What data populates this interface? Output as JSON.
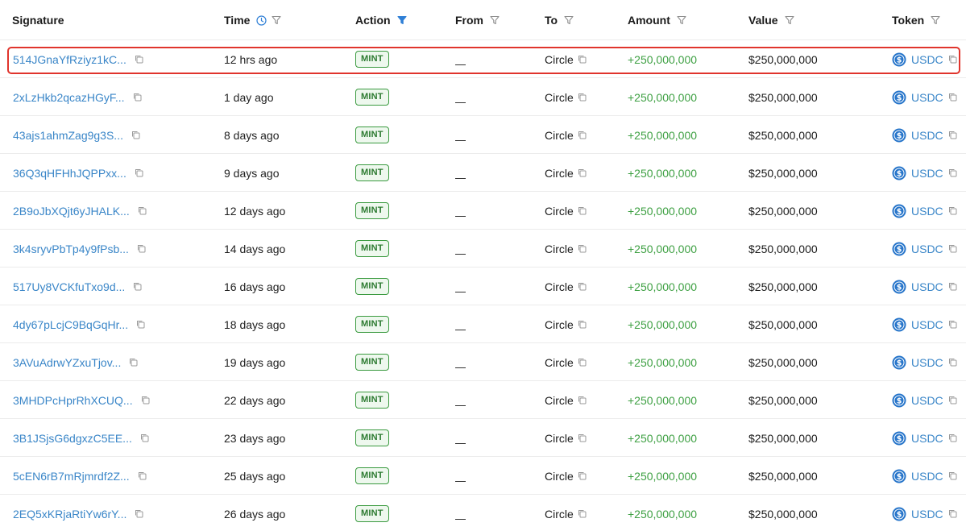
{
  "colors": {
    "link": "#3a86c8",
    "amount": "#3ea043",
    "badge_border": "#3a9a3f",
    "badge_text": "#2c7a30",
    "highlight": "#e0342c",
    "filter_active": "#2f7fd6"
  },
  "columns": {
    "signature": "Signature",
    "time": "Time",
    "action": "Action",
    "from": "From",
    "to": "To",
    "amount": "Amount",
    "value": "Value",
    "token": "Token"
  },
  "rows": [
    {
      "signature": "514JGnaYfRziyz1kC...",
      "time": "12 hrs ago",
      "action": "MINT",
      "from": "",
      "to": "Circle",
      "amount": "+250,000,000",
      "value": "$250,000,000",
      "token": "USDC"
    },
    {
      "signature": "2xLzHkb2qcazHGyF...",
      "time": "1 day ago",
      "action": "MINT",
      "from": "",
      "to": "Circle",
      "amount": "+250,000,000",
      "value": "$250,000,000",
      "token": "USDC"
    },
    {
      "signature": "43ajs1ahmZag9g3S...",
      "time": "8 days ago",
      "action": "MINT",
      "from": "",
      "to": "Circle",
      "amount": "+250,000,000",
      "value": "$250,000,000",
      "token": "USDC"
    },
    {
      "signature": "36Q3qHFHhJQPPxx...",
      "time": "9 days ago",
      "action": "MINT",
      "from": "",
      "to": "Circle",
      "amount": "+250,000,000",
      "value": "$250,000,000",
      "token": "USDC"
    },
    {
      "signature": "2B9oJbXQjt6yJHALK...",
      "time": "12 days ago",
      "action": "MINT",
      "from": "",
      "to": "Circle",
      "amount": "+250,000,000",
      "value": "$250,000,000",
      "token": "USDC"
    },
    {
      "signature": "3k4sryvPbTp4y9fPsb...",
      "time": "14 days ago",
      "action": "MINT",
      "from": "",
      "to": "Circle",
      "amount": "+250,000,000",
      "value": "$250,000,000",
      "token": "USDC"
    },
    {
      "signature": "517Uy8VCKfuTxo9d...",
      "time": "16 days ago",
      "action": "MINT",
      "from": "",
      "to": "Circle",
      "amount": "+250,000,000",
      "value": "$250,000,000",
      "token": "USDC"
    },
    {
      "signature": "4dy67pLcjC9BqGqHr...",
      "time": "18 days ago",
      "action": "MINT",
      "from": "",
      "to": "Circle",
      "amount": "+250,000,000",
      "value": "$250,000,000",
      "token": "USDC"
    },
    {
      "signature": "3AVuAdrwYZxuTjov...",
      "time": "19 days ago",
      "action": "MINT",
      "from": "",
      "to": "Circle",
      "amount": "+250,000,000",
      "value": "$250,000,000",
      "token": "USDC"
    },
    {
      "signature": "3MHDPcHprRhXCUQ...",
      "time": "22 days ago",
      "action": "MINT",
      "from": "",
      "to": "Circle",
      "amount": "+250,000,000",
      "value": "$250,000,000",
      "token": "USDC"
    },
    {
      "signature": "3B1JSjsG6dgxzC5EE...",
      "time": "23 days ago",
      "action": "MINT",
      "from": "",
      "to": "Circle",
      "amount": "+250,000,000",
      "value": "$250,000,000",
      "token": "USDC"
    },
    {
      "signature": "5cEN6rB7mRjmrdf2Z...",
      "time": "25 days ago",
      "action": "MINT",
      "from": "",
      "to": "Circle",
      "amount": "+250,000,000",
      "value": "$250,000,000",
      "token": "USDC"
    },
    {
      "signature": "2EQ5xKRjaRtiYw6rY...",
      "time": "26 days ago",
      "action": "MINT",
      "from": "",
      "to": "Circle",
      "amount": "+250,000,000",
      "value": "$250,000,000",
      "token": "USDC"
    }
  ],
  "icons": {
    "time_header": "clock-icon",
    "filter": "filter-icon",
    "copy": "copy-icon",
    "token": "usdc-coin-icon"
  }
}
